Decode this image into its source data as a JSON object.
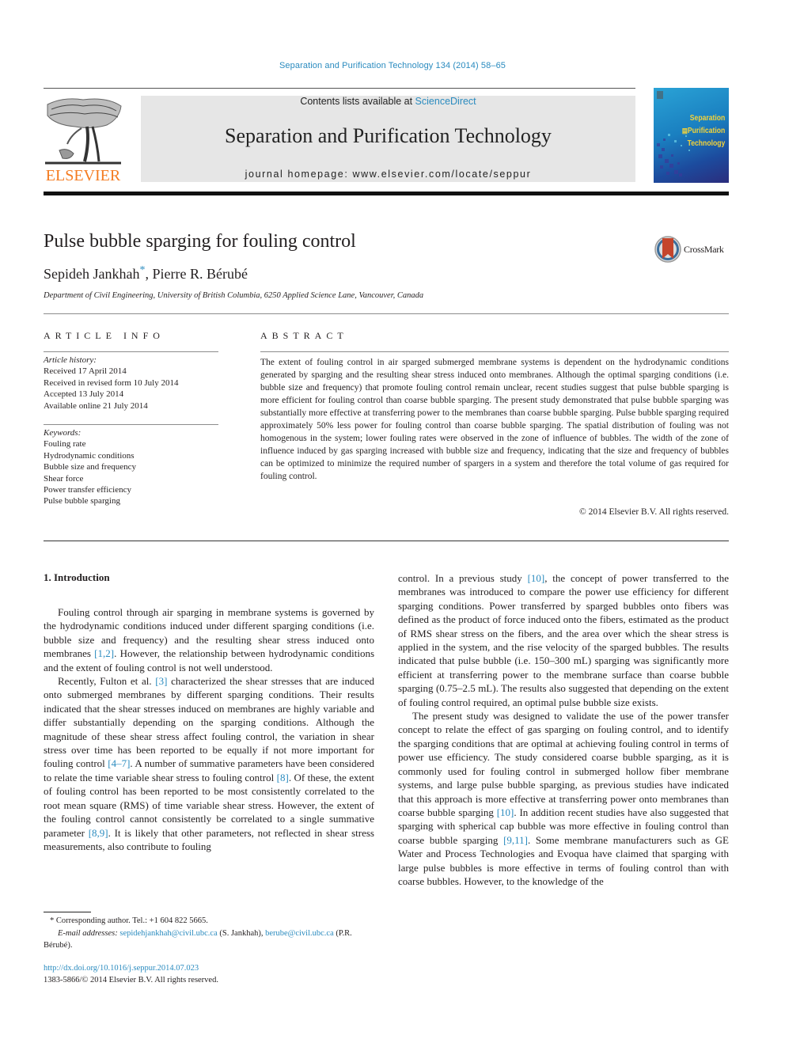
{
  "running_head": "Separation and Purification Technology 134 (2014) 58–65",
  "masthead": {
    "contents_prefix": "Contents lists available at ",
    "contents_link": "ScienceDirect",
    "journal_title": "Separation and Purification Technology",
    "homepage": "journal homepage: www.elsevier.com/locate/seppur"
  },
  "publisher_logo": {
    "wordmark": "ELSEVIER",
    "color": "#f47b20"
  },
  "cover": {
    "line1": "Separation",
    "line2": "Purification",
    "line3": "Technology"
  },
  "article": {
    "title": "Pulse bubble sparging for fouling control",
    "authors": [
      {
        "name": "Sepideh Jankhah",
        "mark": "*"
      },
      {
        "name": "Pierre R. Bérubé",
        "mark": ""
      }
    ],
    "author_sep": ", ",
    "affiliation": "Department of Civil Engineering, University of British Columbia, 6250 Applied Science Lane, Vancouver, Canada",
    "crossmark": "CrossMark"
  },
  "article_info": {
    "heading": "ARTICLE INFO",
    "history_label": "Article history:",
    "history": [
      "Received 17 April 2014",
      "Received in revised form 10 July 2014",
      "Accepted 13 July 2014",
      "Available online 21 July 2014"
    ],
    "keywords_label": "Keywords:",
    "keywords": [
      "Fouling rate",
      "Hydrodynamic conditions",
      "Bubble size and frequency",
      "Shear force",
      "Power transfer efficiency",
      "Pulse bubble sparging"
    ]
  },
  "abstract": {
    "heading": "ABSTRACT",
    "text": "The extent of fouling control in air sparged submerged membrane systems is dependent on the hydrodynamic conditions generated by sparging and the resulting shear stress induced onto membranes. Although the optimal sparging conditions (i.e. bubble size and frequency) that promote fouling control remain unclear, recent studies suggest that pulse bubble sparging is more efficient for fouling control than coarse bubble sparging. The present study demonstrated that pulse bubble sparging was substantially more effective at transferring power to the membranes than coarse bubble sparging. Pulse bubble sparging required approximately 50% less power for fouling control than coarse bubble sparging. The spatial distribution of fouling was not homogenous in the system; lower fouling rates were observed in the zone of influence of bubbles. The width of the zone of influence induced by gas sparging increased with bubble size and frequency, indicating that the size and frequency of bubbles can be optimized to minimize the required number of spargers in a system and therefore the total volume of gas required for fouling control.",
    "copyright": "© 2014 Elsevier B.V. All rights reserved."
  },
  "body": {
    "section_heading": "1. Introduction",
    "left_paragraphs": [
      [
        {
          "t": "Fouling control through air sparging in membrane systems is governed by the hydrodynamic conditions induced under different sparging conditions (i.e. bubble size and frequency) and the resulting shear stress induced onto membranes "
        },
        {
          "ref": "[1,2]"
        },
        {
          "t": ". However, the relationship between hydrodynamic conditions and the extent of fouling control is not well understood."
        }
      ],
      [
        {
          "t": "Recently, Fulton et al. "
        },
        {
          "ref": "[3]"
        },
        {
          "t": " characterized the shear stresses that are induced onto submerged membranes by different sparging conditions. Their results indicated that the shear stresses induced on membranes are highly variable and differ substantially depending on the sparging conditions. Although the magnitude of these shear stress affect fouling control, the variation in shear stress over time has been reported to be equally if not more important for fouling control "
        },
        {
          "ref": "[4–7]"
        },
        {
          "t": ". A number of summative parameters have been considered to relate the time variable shear stress to fouling control "
        },
        {
          "ref": "[8]"
        },
        {
          "t": ". Of these, the extent of fouling control has been reported to be most consistently correlated to the root mean square (RMS) of time variable shear stress. However, the extent of the fouling control cannot consistently be correlated to a single summative parameter "
        },
        {
          "ref": "[8,9]"
        },
        {
          "t": ". It is likely that other parameters, not reflected in shear stress measurements, also contribute to fouling"
        }
      ]
    ],
    "right_paragraphs": [
      [
        {
          "t": "control. In a previous study "
        },
        {
          "ref": "[10]"
        },
        {
          "t": ", the concept of power transferred to the membranes was introduced to compare the power use efficiency for different sparging conditions. Power transferred by sparged bubbles onto fibers was defined as the product of force induced onto the fibers, estimated as the product of RMS shear stress on the fibers, and the area over which the shear stress is applied in the system, and the rise velocity of the sparged bubbles. The results indicated that pulse bubble (i.e. 150–300 mL) sparging was significantly more efficient at transferring power to the membrane surface than coarse bubble sparging (0.75–2.5 mL). The results also suggested that depending on the extent of fouling control required, an optimal pulse bubble size exists."
        }
      ],
      [
        {
          "t": "The present study was designed to validate the use of the power transfer concept to relate the effect of gas sparging on fouling control, and to identify the sparging conditions that are optimal at achieving fouling control in terms of power use efficiency. The study considered coarse bubble sparging, as it is commonly used for fouling control in submerged hollow fiber membrane systems, and large pulse bubble sparging, as previous studies have indicated that this approach is more effective at transferring power onto membranes than coarse bubble sparging "
        },
        {
          "ref": "[10]"
        },
        {
          "t": ". In addition recent studies have also suggested that sparging with spherical cap bubble was more effective in fouling control than coarse bubble sparging "
        },
        {
          "ref": "[9,11]"
        },
        {
          "t": ". Some membrane manufacturers such as GE Water and Process Technologies and Evoqua have claimed that sparging with large pulse bubbles is more effective in terms of fouling control than with coarse bubbles. However, to the knowledge of the"
        }
      ]
    ]
  },
  "footnotes": {
    "corresponding": "* Corresponding author. Tel.: +1 604 822 5665.",
    "email_label": "E-mail addresses: ",
    "email1": "sepidehjankhah@civil.ubc.ca",
    "email1_owner": " (S. Jankhah), ",
    "email2": "berube@civil.ubc.ca",
    "email2_owner": " (P.R. Bérubé).",
    "doi": "http://dx.doi.org/10.1016/j.seppur.2014.07.023",
    "issn": "1383-5866/© 2014 Elsevier B.V. All rights reserved."
  },
  "colors": {
    "link": "#2a8bbf",
    "elsevier_orange": "#f47b20",
    "masthead_bg": "#e6e6e6",
    "cover_title": "#f3d23a"
  }
}
